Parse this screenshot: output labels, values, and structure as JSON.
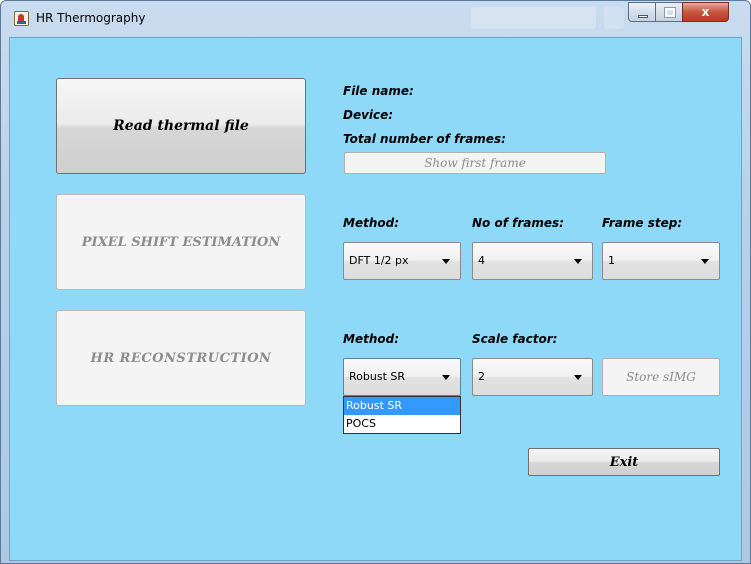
{
  "window": {
    "title": "HR Thermography",
    "close_glyph": "x"
  },
  "read": {
    "button_label": "Read thermal file",
    "file_name_label": "File name:",
    "device_label": "Device:",
    "total_frames_label": "Total number of frames:",
    "show_first_frame_label": "Show first frame"
  },
  "pixel_shift": {
    "button_label": "PIXEL SHIFT ESTIMATION",
    "method_label": "Method:",
    "frames_label": "No of frames:",
    "step_label": "Frame step:",
    "method_value": "DFT 1/2 px",
    "frames_value": "4",
    "step_value": "1"
  },
  "reconstruction": {
    "button_label": "HR  RECONSTRUCTION",
    "method_label": "Method:",
    "scale_label": "Scale factor:",
    "method_value": "Robust SR",
    "scale_value": "2",
    "store_label": "Store sIMG",
    "method_options": [
      "Robust SR",
      "POCS"
    ],
    "selected_option_index": 0
  },
  "exit_label": "Exit",
  "colors": {
    "client_background": "#8ed8f8",
    "selection": "#3399ff",
    "close_button": "#c8553d"
  },
  "icons": [
    "java-app-icon",
    "minimize-icon",
    "maximize-icon",
    "close-icon",
    "chevron-down-icon"
  ]
}
